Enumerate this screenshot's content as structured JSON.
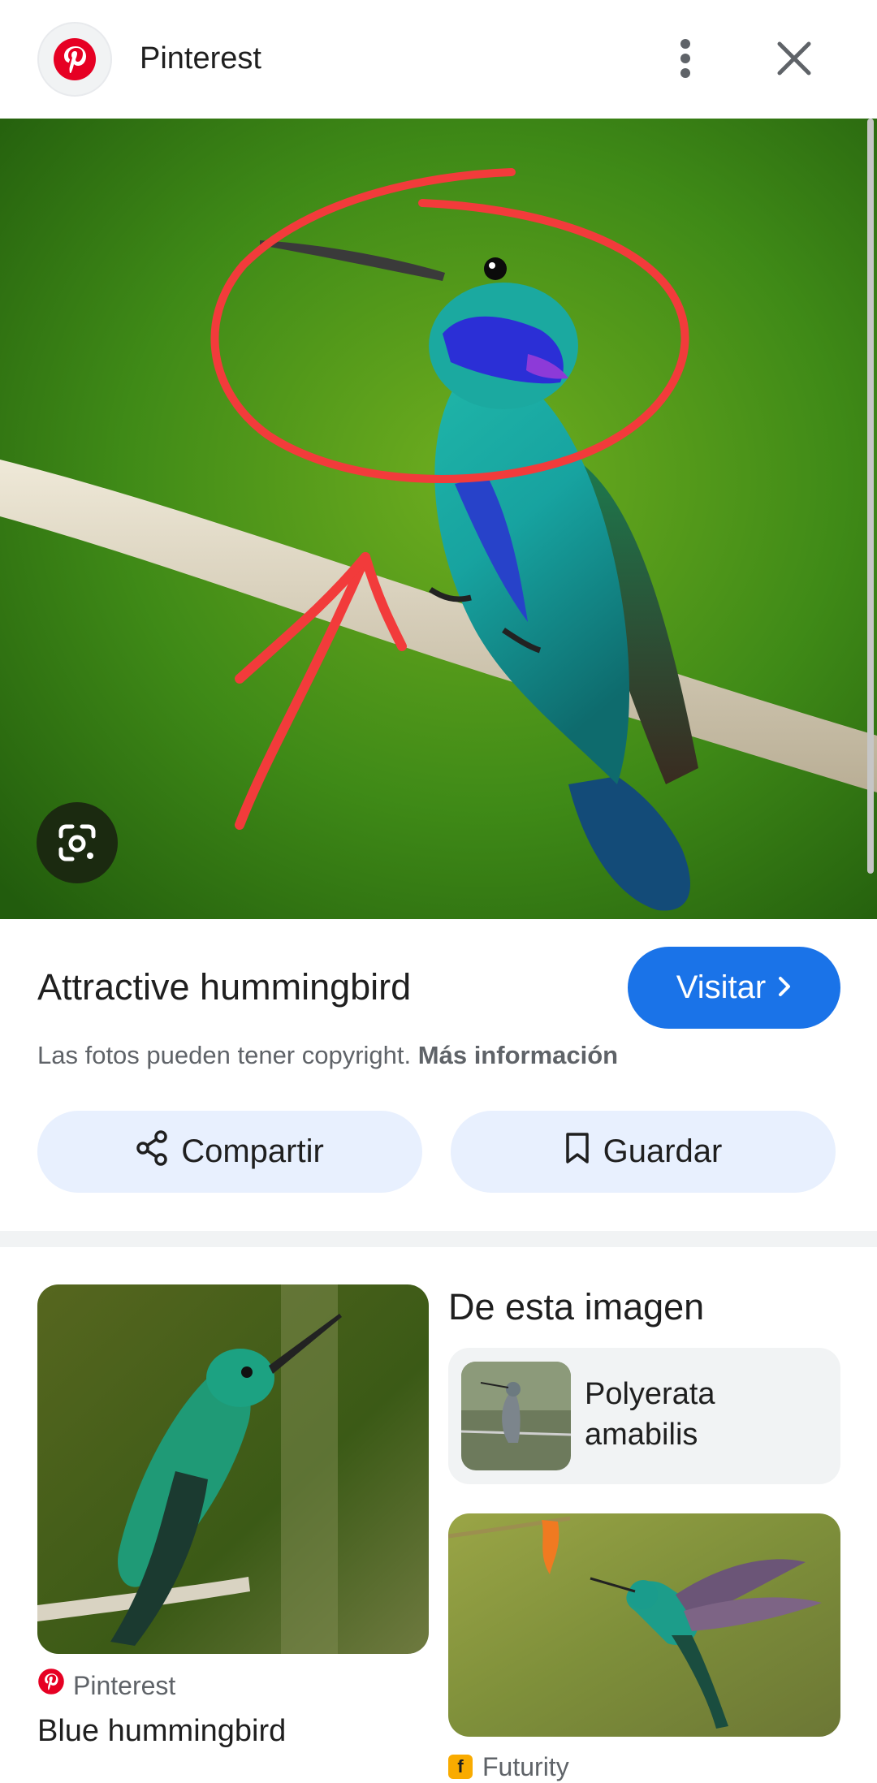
{
  "header": {
    "source_name": "Pinterest",
    "icons": {
      "logo": "pinterest-logo-icon",
      "more": "more-vert-icon",
      "close": "close-icon"
    }
  },
  "hero": {
    "icons": {
      "lens": "google-lens-icon"
    }
  },
  "info": {
    "title": "Attractive hummingbird",
    "visit_label": "Visitar",
    "copyright_text": "Las fotos pueden tener copyright.",
    "copyright_link": "Más información"
  },
  "actions": {
    "share_label": "Compartir",
    "save_label": "Guardar"
  },
  "results": {
    "section_title": "De esta imagen",
    "left_card": {
      "source": "Pinterest",
      "title": "Blue hummingbird"
    },
    "entity": {
      "name": "Polyerata amabilis"
    },
    "right_card": {
      "source": "Futurity"
    }
  },
  "colors": {
    "accent_blue": "#1a73e8",
    "pill_bg": "#e8f0fe",
    "pinterest_red": "#e60023",
    "annotation_red": "#f23b3b"
  }
}
